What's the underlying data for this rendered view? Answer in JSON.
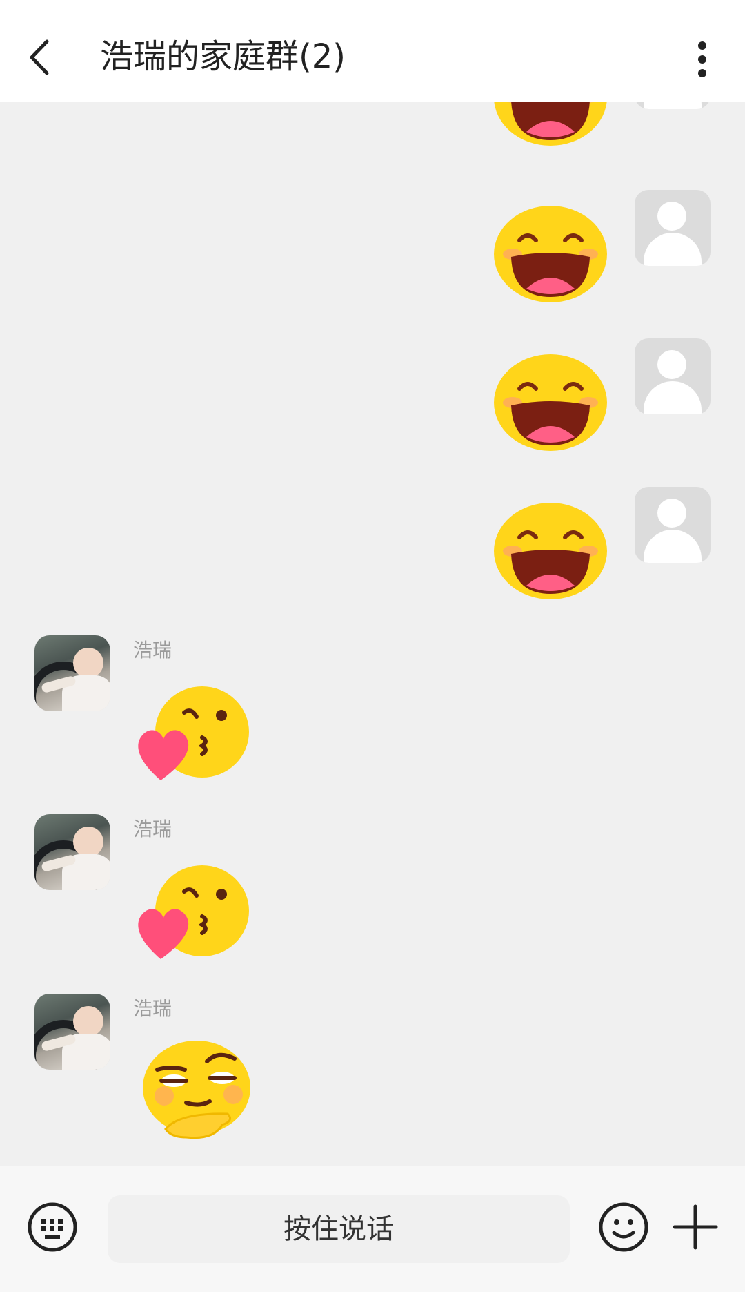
{
  "header": {
    "title": "浩瑞的家庭群(2)"
  },
  "messages": [
    {
      "side": "right",
      "emoji": "laughing-emoji"
    },
    {
      "side": "right",
      "emoji": "laughing-emoji"
    },
    {
      "side": "right",
      "emoji": "laughing-emoji"
    },
    {
      "side": "right",
      "emoji": "laughing-emoji"
    },
    {
      "side": "left",
      "sender": "浩瑞",
      "emoji": "kiss-heart-emoji"
    },
    {
      "side": "left",
      "sender": "浩瑞",
      "emoji": "kiss-heart-emoji"
    },
    {
      "side": "left",
      "sender": "浩瑞",
      "emoji": "smirk-thinking-emoji"
    }
  ],
  "input": {
    "voice_label": "按住说话"
  },
  "colors": {
    "header_bg": "#ffffff",
    "chat_bg": "#f0f0f0",
    "emoji_yellow": "#ffd51a",
    "heart_pink": "#ff4f7a"
  },
  "icons": [
    "back-chevron-icon",
    "more-vertical-icon",
    "keyboard-icon",
    "smile-icon",
    "plus-icon",
    "default-person-icon"
  ]
}
